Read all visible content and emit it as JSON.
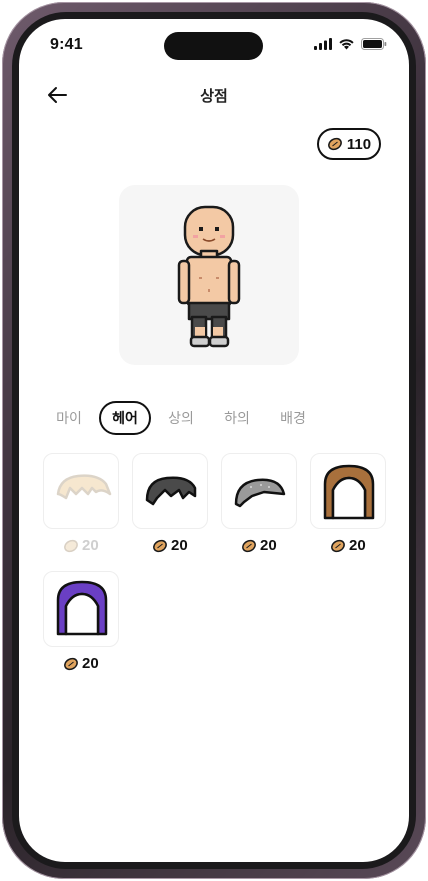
{
  "status_bar": {
    "time": "9:41"
  },
  "header": {
    "title": "상점"
  },
  "wallet": {
    "coins": "110"
  },
  "tabs": [
    {
      "label": "마이",
      "active": false
    },
    {
      "label": "헤어",
      "active": true
    },
    {
      "label": "상의",
      "active": false
    },
    {
      "label": "하의",
      "active": false
    },
    {
      "label": "배경",
      "active": false
    }
  ],
  "items": [
    {
      "icon": "blonde-hair-icon",
      "price": "20",
      "owned": true
    },
    {
      "icon": "dark-gray-hair-icon",
      "price": "20",
      "owned": false
    },
    {
      "icon": "gray-hair-icon",
      "price": "20",
      "owned": false
    },
    {
      "icon": "brown-long-hair-icon",
      "price": "20",
      "owned": false
    },
    {
      "icon": "purple-long-hair-icon",
      "price": "20",
      "owned": false
    }
  ],
  "colors": {
    "coin": "#e0a45f",
    "active_tab_border": "#111111",
    "inactive_tab_text": "#9a9a9a"
  }
}
